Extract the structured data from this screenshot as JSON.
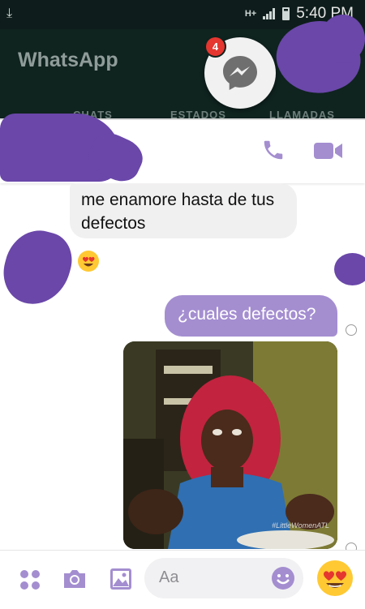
{
  "status_bar": {
    "network": "H+",
    "time": "5:40 PM"
  },
  "background_app": {
    "title": "WhatsApp",
    "tabs": [
      "CHATS",
      "ESTADOS",
      "LLAMADAS"
    ]
  },
  "chat_head": {
    "badge_count": "4",
    "icon": "messenger-icon"
  },
  "chat_header": {
    "icons": [
      "phone-icon",
      "video-call-icon"
    ]
  },
  "messages": [
    {
      "direction": "incoming",
      "text": "me enamore hasta de tus defectos"
    },
    {
      "direction": "incoming",
      "type": "emoji",
      "icon": "heart-eyes-emoji"
    },
    {
      "direction": "outgoing",
      "text": "¿cuales defectos?"
    },
    {
      "direction": "outgoing",
      "type": "photo",
      "watermark": "#LittleWomenATL"
    }
  ],
  "composer": {
    "placeholder": "Aa",
    "buttons": [
      "apps-icon",
      "camera-icon",
      "gallery-icon",
      "emoji-icon",
      "heart-eyes-emoji"
    ]
  },
  "colors": {
    "accent": "#a48ed0",
    "redaction": "#6a47a9",
    "badge": "#e5362f",
    "icon_purple": "#a48ed0"
  }
}
